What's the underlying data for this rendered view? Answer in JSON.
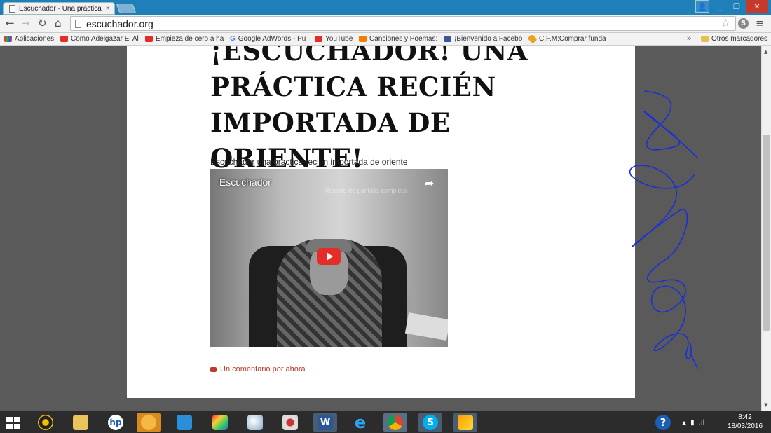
{
  "window": {
    "tab_title": "Escuchador - Una práctica",
    "tab_close": "×"
  },
  "toolbar": {
    "url": "escuchador.org"
  },
  "bookmarks": [
    {
      "label": "Aplicaciones",
      "icon": "apps-grid-icon"
    },
    {
      "label": "Como Adelgazar El Al",
      "icon": "youtube-icon"
    },
    {
      "label": "Empieza de cero a ha",
      "icon": "youtube-icon"
    },
    {
      "label": "Google AdWords - Pu",
      "icon": "google-icon"
    },
    {
      "label": "YouTube",
      "icon": "youtube-icon"
    },
    {
      "label": "Canciones y Poemas:",
      "icon": "blogger-icon"
    },
    {
      "label": "¡Bienvenido a Facebo",
      "icon": "facebook-icon"
    },
    {
      "label": "C.F.M:Comprar funda",
      "icon": "cfm-icon"
    }
  ],
  "bookmarks_more": "»",
  "other_bookmarks": "Otros marcadores",
  "page": {
    "title": "¡ESCUCHADOR! UNA PRÁCTICA RECIÉN IMPORTADA DE ORIENTE!",
    "intro": "Escuchador una practica recién importada de oriente",
    "video": {
      "title": "Escuchador",
      "watermark": "Recorte de pantalla completa"
    },
    "comments_link": "Un comentario por ahora"
  },
  "taskbar": {
    "apps": [
      "music-player",
      "file-explorer",
      "hp",
      "hand-app",
      "rocket-app",
      "puzzle-app",
      "paint-app",
      "tool-app",
      "word",
      "internet-explorer",
      "chrome",
      "skype",
      "media-app"
    ],
    "active_app": "chrome",
    "time": "8:42",
    "date": "18/03/2016"
  },
  "colors": {
    "titlebar": "#1f7fb9",
    "link_red": "#c0392b",
    "scribble_blue": "#1a2fd6",
    "youtube_red": "#e52d27"
  }
}
